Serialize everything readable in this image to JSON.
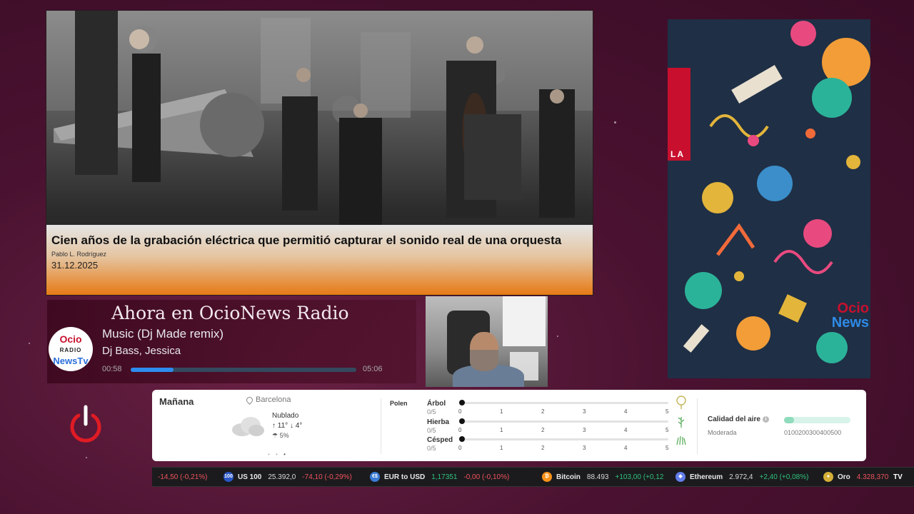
{
  "news": {
    "title": "Cien años de la grabación eléctrica que permitió capturar el sonido real de una orquesta",
    "author": "Pablo L. Rodríguez",
    "date": "31.12.2025"
  },
  "player": {
    "heading": "Ahora en OcioNews Radio",
    "logo_line1": "Ocio",
    "logo_line2": "RADIO",
    "logo_line3": "NewsTv",
    "track_title": "Music (Dj Made remix)",
    "track_artist": "Dj Bass, Jessica",
    "time_elapsed": "00:58",
    "time_total": "05:06",
    "progress_fraction": 0.19
  },
  "art": {
    "side_text": "LA",
    "logo_line1": "Ocio",
    "logo_line2": "News"
  },
  "power": {
    "icon": "power-icon",
    "color": "#e01b24"
  },
  "weather": {
    "day": "Mañana",
    "city": "Barcelona",
    "condition": "Nublado",
    "temp_high": "↑ 11°",
    "temp_low": "↓ 4°",
    "rain": "☂ 5%",
    "pages": [
      "•",
      "•",
      "•"
    ],
    "active_page": 3,
    "pollen_title": "Polen",
    "pollen": [
      {
        "name": "Árbol",
        "value": "0/5",
        "level": 0,
        "icon": "tree-icon"
      },
      {
        "name": "Hierba",
        "value": "0/5",
        "level": 0,
        "icon": "grass-icon"
      },
      {
        "name": "Césped",
        "value": "0/5",
        "level": 0,
        "icon": "lawn-icon"
      }
    ],
    "pollen_ticks": [
      "0",
      "1",
      "2",
      "3",
      "4",
      "5"
    ],
    "air_title": "Calidad del aire",
    "air_info": "i",
    "air_level": "Moderada",
    "air_scale": "0100200300400500",
    "air_fraction": 0.15
  },
  "ticker": [
    {
      "name": "",
      "price": "",
      "change": "-14,50 (-0,21%)",
      "dir": "neg",
      "icon": "",
      "color": ""
    },
    {
      "name": "US 100",
      "price": "25.392,0",
      "change": "-74,10 (-0,29%)",
      "dir": "neg",
      "icon": "100",
      "color": "#2a56c6"
    },
    {
      "name": "EUR to USD",
      "price": "1,17351",
      "change": "-0,00 (-0,10%)",
      "dir": "neg",
      "icon": "€$",
      "color": "#3a7bd5"
    },
    {
      "name": "Bitcoin",
      "price": "88.493",
      "change": "+103,00 (+0,12",
      "dir": "pos",
      "icon": "₿",
      "color": "#f7931a"
    },
    {
      "name": "Ethereum",
      "price": "2.972,4",
      "change": "+2,40 (+0,08%)",
      "dir": "pos",
      "icon": "◆",
      "color": "#627eea"
    },
    {
      "name": "Oro",
      "price": "4.328,370",
      "change": "",
      "dir": "neg",
      "icon": "●",
      "color": "#d4af37"
    }
  ],
  "ticker_tail": "TV"
}
